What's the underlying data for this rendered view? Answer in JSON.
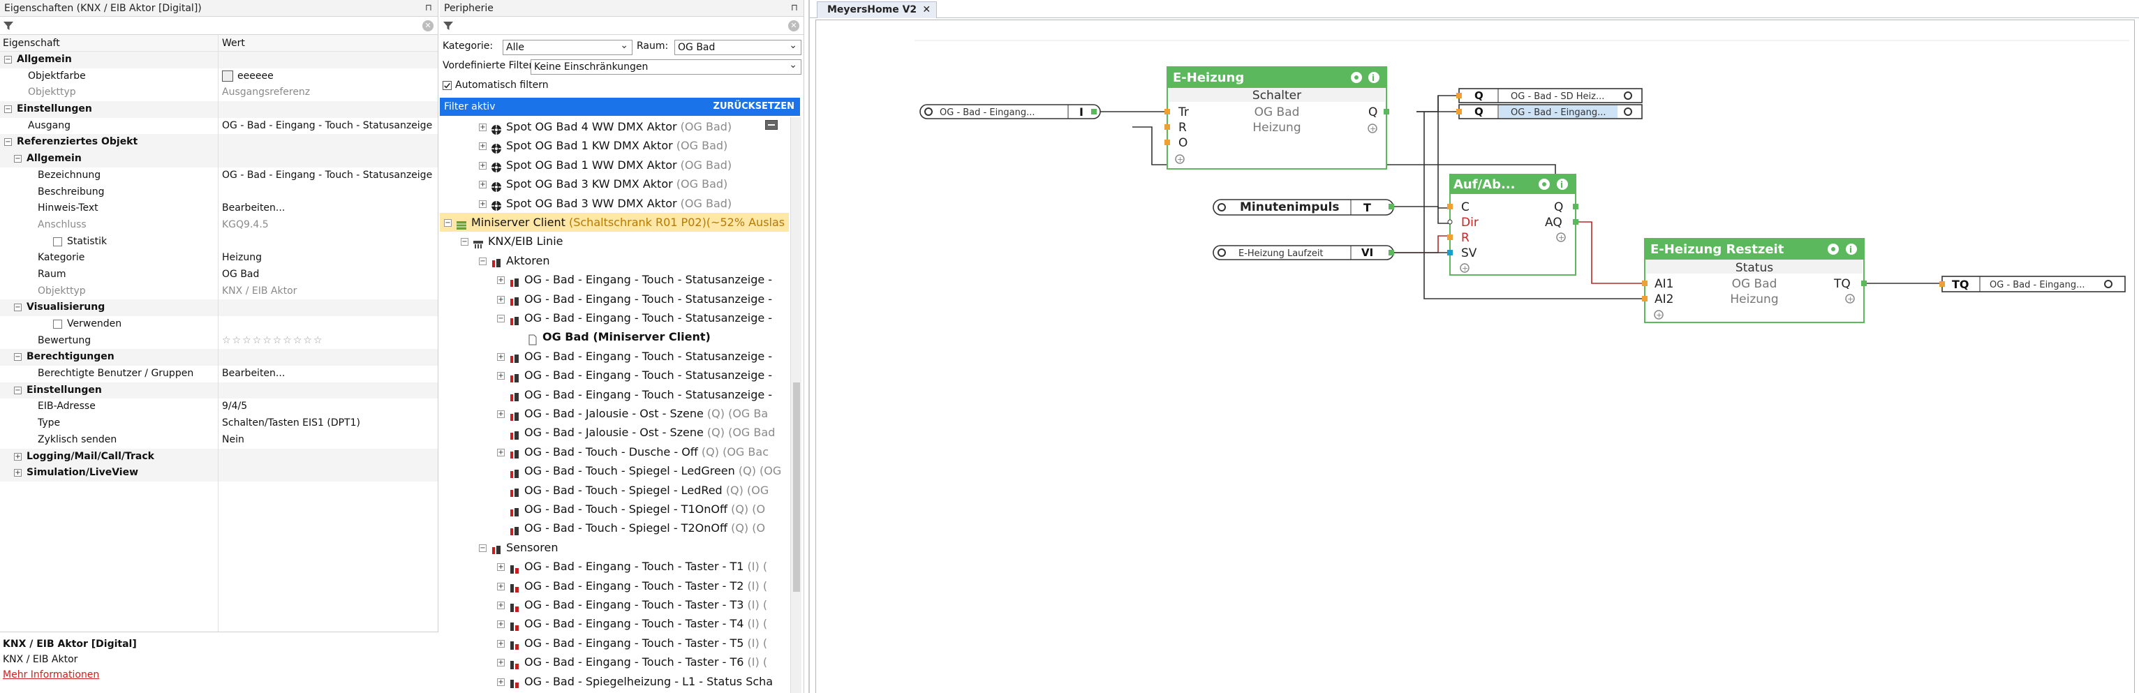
{
  "props": {
    "title": "Eigenschaften (KNX / EIB Aktor [Digital])",
    "col_key": "Eigenschaft",
    "col_value": "Wert",
    "rows": [
      {
        "k": "Allgemein",
        "v": ""
      },
      {
        "k": "Objektfarbe",
        "v": "eeeeee"
      },
      {
        "k": "Objekttyp",
        "v": "Ausgangsreferenz"
      },
      {
        "k": "Einstellungen",
        "v": ""
      },
      {
        "k": "Ausgang",
        "v": "OG - Bad - Eingang - Touch - Statusanzeige ..."
      },
      {
        "k": "Referenziertes Objekt",
        "v": ""
      },
      {
        "k": "Allgemein",
        "v": ""
      },
      {
        "k": "Bezeichnung",
        "v": "OG - Bad - Eingang - Touch - Statusanzeige ..."
      },
      {
        "k": "Beschreibung",
        "v": ""
      },
      {
        "k": "Hinweis-Text",
        "v": "Bearbeiten..."
      },
      {
        "k": "Anschluss",
        "v": "KGQ9.4.5"
      },
      {
        "k": "Statistik",
        "v": ""
      },
      {
        "k": "Kategorie",
        "v": "Heizung"
      },
      {
        "k": "Raum",
        "v": "OG Bad"
      },
      {
        "k": "Objekttyp",
        "v": "KNX / EIB Aktor"
      },
      {
        "k": "Visualisierung",
        "v": ""
      },
      {
        "k": "Verwenden",
        "v": ""
      },
      {
        "k": "Bewertung",
        "v": "☆☆☆☆☆☆☆☆☆☆"
      },
      {
        "k": "Berechtigungen",
        "v": ""
      },
      {
        "k": "Berechtigte Benutzer / Gruppen",
        "v": "Bearbeiten..."
      },
      {
        "k": "Einstellungen",
        "v": ""
      },
      {
        "k": "EIB-Adresse",
        "v": "9/4/5"
      },
      {
        "k": "Type",
        "v": "Schalten/Tasten EIS1 (DPT1)"
      },
      {
        "k": "Zyklisch senden",
        "v": "Nein"
      },
      {
        "k": "Logging/Mail/Call/Track",
        "v": ""
      },
      {
        "k": "Simulation/LiveView",
        "v": ""
      }
    ],
    "footer_title": "KNX / EIB Aktor [Digital]",
    "footer_sub": "KNX / EIB Aktor",
    "footer_link": "Mehr Informationen"
  },
  "peri": {
    "title": "Peripherie",
    "kategorie_label": "Kategorie:",
    "kategorie_value": "Alle",
    "raum_label": "Raum:",
    "raum_value": "OG Bad",
    "vordef_label": "Vordefinierte Filter",
    "vordef_value": "Keine Einschränkungen",
    "auto_filter_label": "Automatisch filtern",
    "filter_active": "Filter aktiv",
    "reset": "ZURÜCKSETZEN",
    "tree": [
      {
        "label": "Spot OG Bad 4 WW DMX Aktor",
        "room": "(OG Bad)"
      },
      {
        "label": "Spot OG Bad 1 KW DMX Aktor",
        "room": "(OG Bad)"
      },
      {
        "label": "Spot OG Bad 1 WW DMX Aktor",
        "room": "(OG Bad)"
      },
      {
        "label": "Spot OG Bad 3 KW DMX Aktor",
        "room": "(OG Bad)"
      },
      {
        "label": "Spot OG Bad 3 WW DMX Aktor",
        "room": "(OG Bad)"
      },
      {
        "label": "Miniserver Client",
        "room": "(Schaltschrank R01 P02)(~52% Auslas"
      },
      {
        "label": "KNX/EIB Linie",
        "room": ""
      },
      {
        "label": "Aktoren",
        "room": ""
      },
      {
        "label": "OG - Bad - Eingang - Touch - Statusanzeige -",
        "room": ""
      },
      {
        "label": "OG - Bad - Eingang - Touch - Statusanzeige -",
        "room": ""
      },
      {
        "label": "OG - Bad - Eingang - Touch - Statusanzeige -",
        "room": ""
      },
      {
        "label": "OG Bad (Miniserver Client)",
        "room": ""
      },
      {
        "label": "OG - Bad - Eingang - Touch - Statusanzeige -",
        "room": ""
      },
      {
        "label": "OG - Bad - Eingang - Touch - Statusanzeige -",
        "room": ""
      },
      {
        "label": "OG - Bad - Eingang - Touch - Statusanzeige -",
        "room": ""
      },
      {
        "label": "OG - Bad - Jalousie - Ost - Szene",
        "room": "(Q) (OG Ba"
      },
      {
        "label": "OG - Bad - Jalousie - Ost - Szene",
        "room": "(Q) (OG Bad"
      },
      {
        "label": "OG - Bad - Touch - Dusche - Off",
        "room": "(Q) (OG Bac"
      },
      {
        "label": "OG - Bad - Touch - Spiegel - LedGreen",
        "room": "(Q) (OG"
      },
      {
        "label": "OG - Bad - Touch - Spiegel - LedRed",
        "room": "(Q) (OG"
      },
      {
        "label": "OG - Bad - Touch - Spiegel - T1OnOff",
        "room": "(Q) (O"
      },
      {
        "label": "OG - Bad - Touch - Spiegel - T2OnOff",
        "room": "(Q) (O"
      },
      {
        "label": "Sensoren",
        "room": ""
      },
      {
        "label": "OG - Bad - Eingang - Touch - Taster - T1",
        "room": "(I) ("
      },
      {
        "label": "OG - Bad - Eingang - Touch - Taster - T2",
        "room": "(I) ("
      },
      {
        "label": "OG - Bad - Eingang - Touch - Taster - T3",
        "room": "(I) ("
      },
      {
        "label": "OG - Bad - Eingang - Touch - Taster - T4",
        "room": "(I) ("
      },
      {
        "label": "OG - Bad - Eingang - Touch - Taster - T5",
        "room": "(I) ("
      },
      {
        "label": "OG - Bad - Eingang - Touch - Taster - T6",
        "room": "(I) ("
      },
      {
        "label": "OG - Bad - Spiegelheizung - L1 - Status Scha",
        "room": ""
      }
    ]
  },
  "canvas": {
    "tab": "MeyersHome V2",
    "tab_close": "✕",
    "input1": {
      "name": "OG - Bad - Eingang...",
      "pin": "I"
    },
    "minuten": {
      "name": "Minutenimpuls",
      "pin": "T"
    },
    "laufzeit": {
      "name": "E-Heizung Laufzeit",
      "pin": "VI"
    },
    "out_q1": {
      "pin": "Q",
      "name": "OG - Bad - SD Heiz..."
    },
    "out_q2": {
      "pin": "Q",
      "name": "OG - Bad - Eingang..."
    },
    "out_tq": {
      "pin": "TQ",
      "name": "OG - Bad - Eingang..."
    },
    "eheizung": {
      "title": "E-Heizung",
      "sub": "Schalter",
      "room": "OG Bad",
      "cat": "Heizung",
      "in": [
        "Tr",
        "R",
        "O"
      ],
      "out": "Q"
    },
    "aufab": {
      "title": "Auf/Ab...",
      "in": [
        "C",
        "Dir",
        "R",
        "SV"
      ],
      "out": [
        "Q",
        "AQ"
      ]
    },
    "restzeit": {
      "title": "E-Heizung Restzeit",
      "sub": "Status",
      "room": "OG Bad",
      "cat": "Heizung",
      "in": [
        "AI1",
        "AI2"
      ],
      "out": "TQ"
    },
    "colors": {
      "block": "#5cb85c",
      "wire": "#333333",
      "wire_red": "#b52a2a",
      "red_text": "#d21f1f",
      "selected": "#cfe3f7"
    }
  }
}
